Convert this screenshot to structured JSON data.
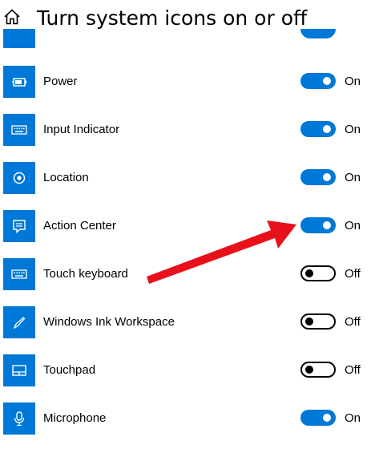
{
  "header": {
    "title": "Turn system icons on or off",
    "home_icon": "home-icon"
  },
  "accent_color": "#0078d7",
  "annotation_color": "#e8101a",
  "rows": [
    {
      "key": "power",
      "label": "Power",
      "icon": "battery-icon",
      "on": true,
      "state": "On"
    },
    {
      "key": "input-indicator",
      "label": "Input Indicator",
      "icon": "keyboard-icon",
      "on": true,
      "state": "On"
    },
    {
      "key": "location",
      "label": "Location",
      "icon": "location-icon",
      "on": true,
      "state": "On"
    },
    {
      "key": "action-center",
      "label": "Action Center",
      "icon": "action-center-icon",
      "on": true,
      "state": "On"
    },
    {
      "key": "touch-keyboard",
      "label": "Touch keyboard",
      "icon": "keyboard-icon",
      "on": false,
      "state": "Off"
    },
    {
      "key": "windows-ink-workspace",
      "label": "Windows Ink Workspace",
      "icon": "pen-icon",
      "on": false,
      "state": "Off"
    },
    {
      "key": "touchpad",
      "label": "Touchpad",
      "icon": "touchpad-icon",
      "on": false,
      "state": "Off"
    },
    {
      "key": "microphone",
      "label": "Microphone",
      "icon": "microphone-icon",
      "on": true,
      "state": "On"
    }
  ]
}
